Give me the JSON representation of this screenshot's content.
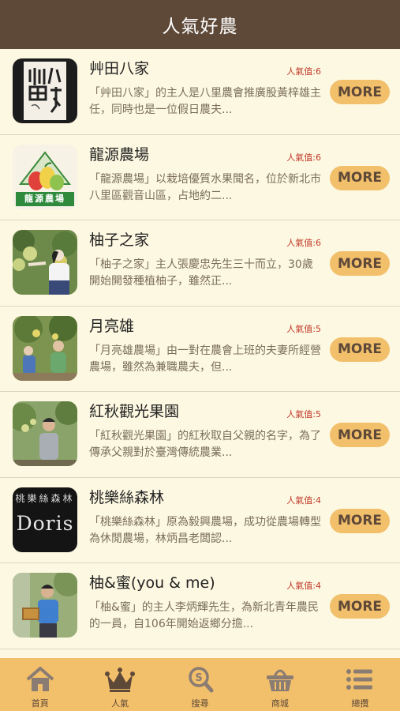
{
  "header": {
    "title": "人氣好農"
  },
  "colors": {
    "header_bg": "#5e4938",
    "page_bg": "#fdf8e1",
    "more_bg": "#f2bf6b",
    "score_red": "#c0392b",
    "tabbar_bg": "#f2bf6b"
  },
  "farms": [
    {
      "name": "艸田八家",
      "score": "人氣值:6",
      "desc": "「艸田八家」的主人是八里農會推廣股黃梓雄主任，同時也是一位假日農夫...",
      "more": "MORE",
      "image": "calligraphy-photo"
    },
    {
      "name": "龍源農場",
      "score": "人氣值:6",
      "desc": "「龍源農場」以栽培優質水果聞名，位於新北市八里區觀音山區，占地約二...",
      "more": "MORE",
      "image": "longyuan-logo",
      "logo_text": "龍源農場"
    },
    {
      "name": "柚子之家",
      "score": "人氣值:6",
      "desc": "「柚子之家」主人張慶忠先生三十而立，30歲開始開發種植柚子，雖然正...",
      "more": "MORE",
      "image": "pomelo-photo"
    },
    {
      "name": "月亮雄",
      "score": "人氣值:5",
      "desc": "「月亮雄農場」由一對在農會上班的夫妻所經營農場，雖然為兼職農夫，但...",
      "more": "MORE",
      "image": "couple-photo"
    },
    {
      "name": "紅秋觀光果園",
      "score": "人氣值:5",
      "desc": "「紅秋觀光果園」的紅秋取自父親的名字，為了傳承父親對於臺灣傳統農業...",
      "more": "MORE",
      "image": "orchard-photo"
    },
    {
      "name": "桃樂絲森林",
      "score": "人氣值:4",
      "desc": "「桃樂絲森林」原為毅興農場，成功從農場轉型為休閒農場，林炳昌老闆認...",
      "more": "MORE",
      "image": "doris-logo",
      "logo_text": "Doris",
      "logo_sub": "桃樂絲森林"
    },
    {
      "name": "柚&蜜(you & me)",
      "score": "人氣值:4",
      "desc": "「柚&蜜」的主人李炳輝先生，為新北青年農民的一員，自106年開始返鄉分擔...",
      "more": "MORE",
      "image": "beekeeper-photo"
    }
  ],
  "tabbar": [
    {
      "label": "首頁",
      "icon": "home-icon"
    },
    {
      "label": "人氣",
      "icon": "crown-icon"
    },
    {
      "label": "搜尋",
      "icon": "search-icon"
    },
    {
      "label": "商城",
      "icon": "basket-icon"
    },
    {
      "label": "總攬",
      "icon": "menu-icon"
    }
  ]
}
